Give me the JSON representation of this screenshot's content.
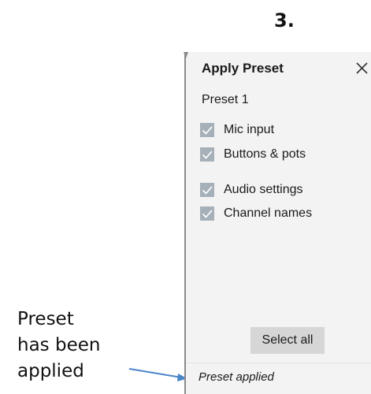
{
  "step": {
    "label": "3."
  },
  "annotation": {
    "lines": [
      "Preset",
      "has been",
      "applied"
    ]
  },
  "panel": {
    "title": "Apply Preset",
    "close_icon": "close-icon",
    "preset_name": "Preset 1",
    "options": [
      {
        "label": "Mic input",
        "checked": true
      },
      {
        "label": "Buttons & pots",
        "checked": true
      },
      {
        "label": "Audio settings",
        "checked": true
      },
      {
        "label": "Channel names",
        "checked": true
      }
    ],
    "select_all_label": "Select all",
    "status": "Preset applied"
  },
  "colors": {
    "panel_bg": "#f3f3f3",
    "checkbox": "#a6b0b8",
    "button_bg": "#d6d6d6",
    "arrow": "#4a86c8"
  }
}
